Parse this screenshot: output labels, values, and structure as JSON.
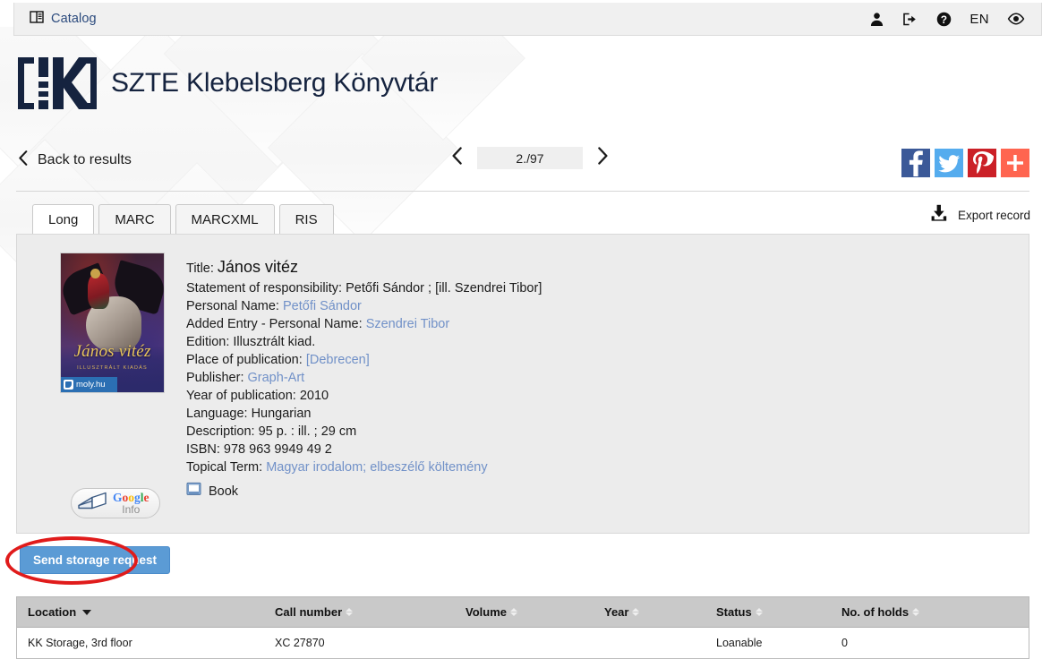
{
  "topbar": {
    "catalog_label": "Catalog",
    "catalog_icon": "book-catalog-icon",
    "account_icon": "user-icon",
    "logout_icon": "sign-out-icon",
    "help_icon": "question-circle-icon",
    "language": "EN",
    "accessibility_icon": "eye-icon"
  },
  "header": {
    "logo_mark": "[!K]",
    "library_name": "SZTE Klebelsberg Könyvtár"
  },
  "nav": {
    "back_label": "Back to results",
    "back_icon": "chevron-left-icon",
    "prev_icon": "chevron-left-icon",
    "next_icon": "chevron-right-icon",
    "page_indicator": "2./97"
  },
  "social": {
    "items": [
      {
        "name": "facebook",
        "glyph": "f",
        "color": "#3b5998"
      },
      {
        "name": "twitter",
        "glyph": "bird",
        "color": "#55acee"
      },
      {
        "name": "pinterest",
        "glyph": "P",
        "color": "#cb2027"
      },
      {
        "name": "share-more",
        "glyph": "+",
        "color": "#ff6550"
      }
    ]
  },
  "tabs": [
    {
      "label": "Long",
      "active": true
    },
    {
      "label": "MARC",
      "active": false
    },
    {
      "label": "MARCXML",
      "active": false
    },
    {
      "label": "RIS",
      "active": false
    }
  ],
  "export": {
    "label": "Export record",
    "icon": "download-icon"
  },
  "record": {
    "cover": {
      "title_on_cover": "János vitéz",
      "subtitle_on_cover": "ILLUSZTRÁLT KIADÁS",
      "badge_label": "moly.hu"
    },
    "google_info": {
      "brand": "Google",
      "label": "Info",
      "g_letters": [
        {
          "ch": "G",
          "color": "#4285F4"
        },
        {
          "ch": "o",
          "color": "#EA4335"
        },
        {
          "ch": "o",
          "color": "#FBBC05"
        },
        {
          "ch": "g",
          "color": "#4285F4"
        },
        {
          "ch": "l",
          "color": "#34A853"
        },
        {
          "ch": "e",
          "color": "#EA4335"
        }
      ]
    },
    "fields": [
      {
        "label": "Title:",
        "value": "János vitéz",
        "link": false,
        "big": true
      },
      {
        "label": "Statement of responsibility:",
        "value": "Petőfi Sándor ; [ill. Szendrei Tibor]",
        "link": false
      },
      {
        "label": "Personal Name:",
        "value": "Petőfi Sándor",
        "link": true
      },
      {
        "label": "Added Entry - Personal Name:",
        "value": "Szendrei Tibor",
        "link": true
      },
      {
        "label": "Edition:",
        "value": "Illusztrált kiad.",
        "link": false
      },
      {
        "label": "Place of publication:",
        "value": "[Debrecen]",
        "link": true
      },
      {
        "label": "Publisher:",
        "value": "Graph-Art",
        "link": true
      },
      {
        "label": "Year of publication:",
        "value": "2010",
        "link": false
      },
      {
        "label": "Language:",
        "value": "Hungarian",
        "link": false
      },
      {
        "label": "Description:",
        "value": "95 p. : ill. ; 29 cm",
        "link": false
      },
      {
        "label": "ISBN:",
        "value": "978 963 9949 49 2",
        "link": false
      },
      {
        "label": "Topical Term:",
        "value": "Magyar irodalom; elbeszélő költemény",
        "link": true
      }
    ],
    "media_type": {
      "label": "Book",
      "icon": "book-icon"
    }
  },
  "storage_request": {
    "label": "Send storage request",
    "color": "#5b9bd5",
    "annotation_color": "#e01b1b"
  },
  "holdings": {
    "columns": [
      {
        "label": "Location",
        "sort": "desc"
      },
      {
        "label": "Call number",
        "sort": "none"
      },
      {
        "label": "Volume",
        "sort": "none"
      },
      {
        "label": "Year",
        "sort": "none"
      },
      {
        "label": "Status",
        "sort": "none"
      },
      {
        "label": "No. of holds",
        "sort": "none"
      }
    ],
    "rows": [
      {
        "location": "KK Storage, 3rd floor",
        "call_number": "XC 27870",
        "volume": "",
        "year": "",
        "status": "Loanable",
        "holds": "0"
      }
    ]
  }
}
